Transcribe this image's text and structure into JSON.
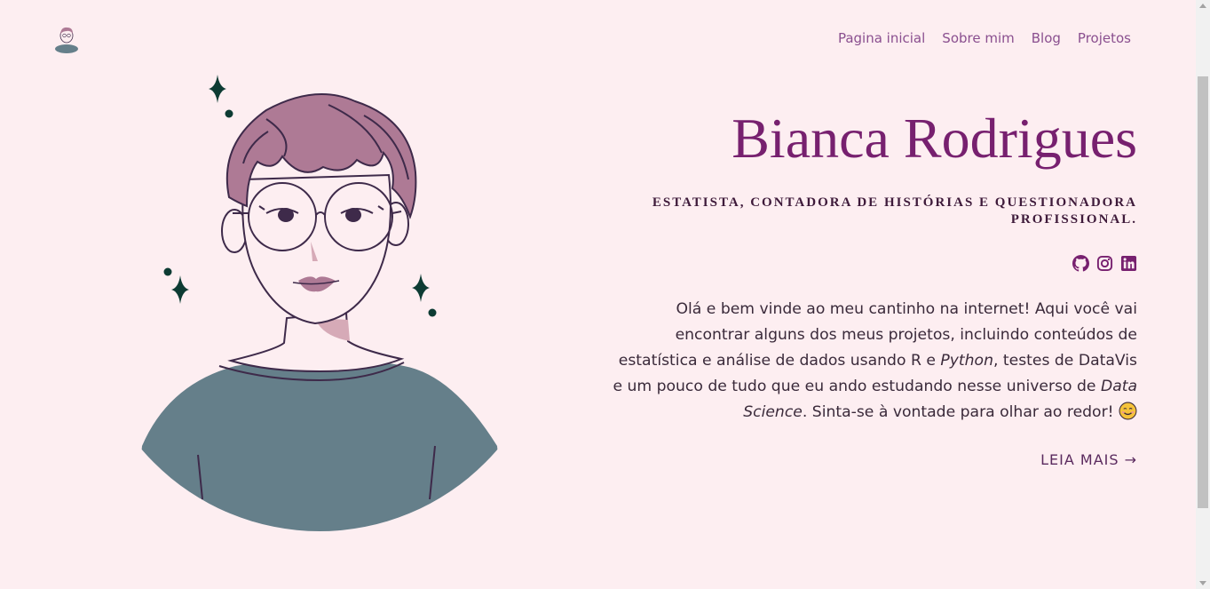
{
  "header": {
    "logo_icon": "avatar-logo-icon",
    "nav": [
      {
        "label": "Pagina inicial"
      },
      {
        "label": "Sobre mim"
      },
      {
        "label": "Blog"
      },
      {
        "label": "Projetos"
      }
    ]
  },
  "hero": {
    "name": "Bianca Rodrigues",
    "subtitle": "Estatista, contadora de histórias e questionadora profissional.",
    "socials": [
      {
        "icon": "github-icon"
      },
      {
        "icon": "instagram-icon"
      },
      {
        "icon": "linkedin-icon"
      }
    ],
    "intro": {
      "part1": "Olá e bem vinde ao meu cantinho na internet! Aqui você vai encontrar alguns dos meus projetos, incluindo conteúdos de estatística e análise de dados usando R e ",
      "em1": "Python",
      "part2": ", testes de DataVis e um pouco de tudo que eu ando estudando nesse universo de ",
      "em2": "Data Science",
      "part3": ". Sinta-se à vontade para olhar ao redor! "
    },
    "read_more": "LEIA MAIS →"
  },
  "colors": {
    "background": "#fdeef1",
    "accent": "#77206f",
    "nav_link": "#8a4f8f",
    "hair": "#ae7a95",
    "shirt": "#657f8a",
    "sparkle": "#0d3b33"
  }
}
